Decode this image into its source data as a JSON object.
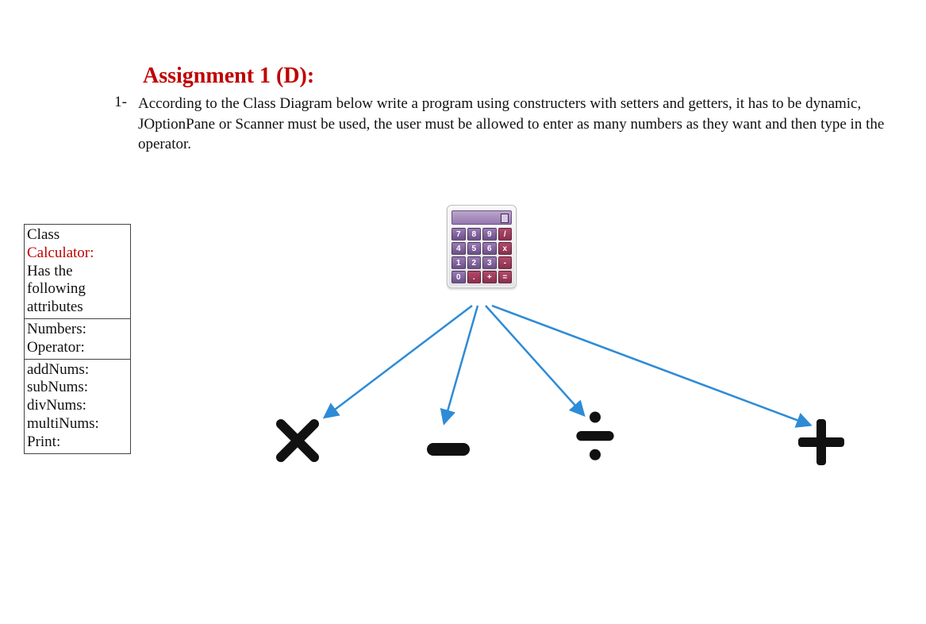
{
  "title": "Assignment 1 (D):",
  "list": {
    "num": "1-",
    "body": "According to the Class Diagram below write a program using constructers with setters and getters, it has to be dynamic, JOptionPane or Scanner must be used, the user must be allowed to enter as many numbers as they want and then type in the operator."
  },
  "classBox": {
    "section1": {
      "line1": "Class",
      "line2": "Calculator:",
      "line3": "Has the",
      "line4": "following",
      "line5": "attributes"
    },
    "section2": {
      "line1": "Numbers:",
      "line2": "Operator:"
    },
    "section3": {
      "line1": "addNums:",
      "line2": "subNums:",
      "line3": "divNums:",
      "line4": "multiNums:",
      "line5": "Print:"
    }
  },
  "calculator": {
    "keys": [
      "7",
      "8",
      "9",
      "/",
      "4",
      "5",
      "6",
      "x",
      "1",
      "2",
      "3",
      "-",
      "0",
      ".",
      "+",
      "="
    ],
    "opCols": [
      3,
      7,
      11,
      13,
      14,
      15
    ]
  },
  "operators": {
    "multiply": "×",
    "subtract": "−",
    "divide": "÷",
    "add": "+"
  }
}
